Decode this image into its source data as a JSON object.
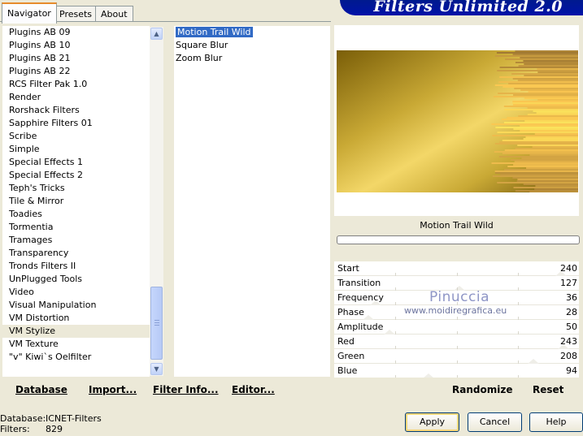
{
  "tabs": [
    {
      "label": "Navigator"
    },
    {
      "label": "Presets"
    },
    {
      "label": "About"
    }
  ],
  "banner": {
    "title": "Filters Unlimited 2.0"
  },
  "categories": [
    "Plugins AB 09",
    "Plugins AB 10",
    "Plugins AB 21",
    "Plugins AB 22",
    "RCS Filter Pak 1.0",
    "Render",
    "Rorshack Filters",
    "Sapphire Filters 01",
    "Scribe",
    "Simple",
    "Special Effects 1",
    "Special Effects 2",
    "Teph's Tricks",
    "Tile & Mirror",
    "Toadies",
    "Tormentia",
    "Tramages",
    "Transparency",
    "Tronds Filters II",
    "UnPlugged Tools",
    "Video",
    "Visual Manipulation",
    "VM Distortion",
    "VM Stylize",
    "VM Texture",
    "\"v\" Kiwi`s Oelfilter"
  ],
  "selected_category": "VM Stylize",
  "filters": [
    "Motion Trail Wild",
    "Square Blur",
    "Zoom Blur"
  ],
  "selected_filter": "Motion Trail Wild",
  "preview": {
    "filter_name": "Motion Trail Wild",
    "progress": 0
  },
  "parameters": [
    {
      "label": "Start",
      "value": "240",
      "level": 0.94
    },
    {
      "label": "Transition",
      "value": "127",
      "level": 0.5
    },
    {
      "label": "Frequency",
      "value": "36",
      "level": 0.14
    },
    {
      "label": "Phase",
      "value": "28",
      "level": 0.11
    },
    {
      "label": "Amplitude",
      "value": "50",
      "level": 0.2
    },
    {
      "label": "Red",
      "value": "243",
      "level": 0.95
    },
    {
      "label": "Green",
      "value": "208",
      "level": 0.82
    },
    {
      "label": "Blue",
      "value": "94",
      "level": 0.37
    }
  ],
  "watermark": {
    "name": "Pinuccia",
    "site": "www.moidiregrafica.eu"
  },
  "left_buttons": {
    "database": "Database",
    "import": "Import...",
    "filter_info": "Filter Info...",
    "editor": "Editor..."
  },
  "right_buttons": {
    "randomize": "Randomize",
    "reset": "Reset"
  },
  "footer": {
    "database_label": "Database:",
    "database_value": "ICNET-Filters",
    "filters_label": "Filters:",
    "filters_value": "829"
  },
  "dialog_buttons": {
    "apply": "Apply",
    "cancel": "Cancel",
    "help": "Help"
  },
  "colors": {
    "accent": "#316ac5",
    "banner": "#0012a8",
    "tab_highlight": "#e68b2c",
    "gold": "#e8c850"
  }
}
